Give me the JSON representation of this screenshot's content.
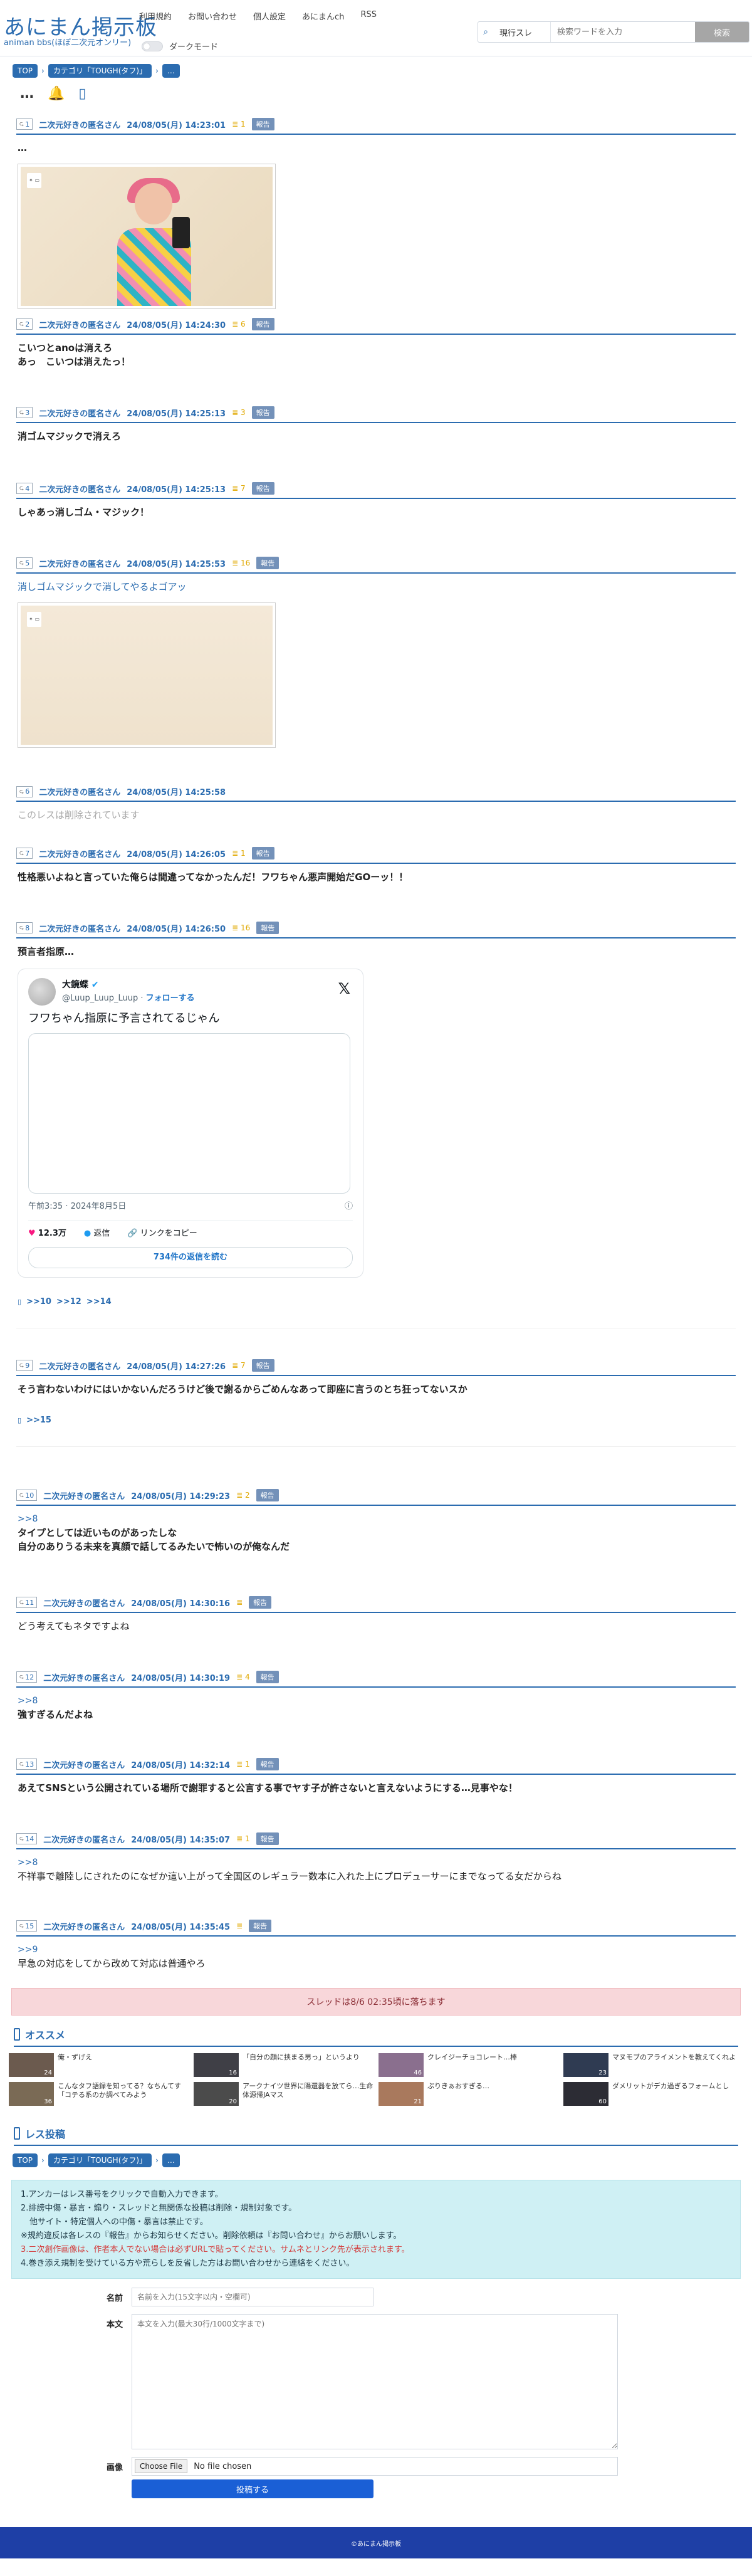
{
  "header": {
    "logo_main": "あにまん掲示板",
    "logo_sub": "animan bbs(ほぼ二次元オンリー)",
    "nav": [
      "利用規約",
      "お問い合わせ",
      "個人設定",
      "あにまんch",
      "RSS"
    ],
    "darkmode_label": "ダークモード",
    "search_scope": "現行スレ",
    "search_placeholder": "検索ワードを入力",
    "search_button": "検索"
  },
  "breadcrumb": {
    "top": "TOP",
    "category": "カテゴリ「TOUGH(タフ)」",
    "current": "…"
  },
  "thread_icons": {
    "menu": "…",
    "bell": "bell-icon",
    "book": "book-icon"
  },
  "posts": [
    {
      "num": "1",
      "name": "二次元好きの匿名さん",
      "date": "24/08/05(月) 14:23:01",
      "refs": "1",
      "report": "報告",
      "body_lines": [
        "…"
      ],
      "has_image": true
    },
    {
      "num": "2",
      "name": "二次元好きの匿名さん",
      "date": "24/08/05(月) 14:24:30",
      "refs": "6",
      "report": "報告",
      "body_lines": [
        "こいつとanoは消えろ",
        "あっ　こいつは消えたっ！"
      ]
    },
    {
      "num": "3",
      "name": "二次元好きの匿名さん",
      "date": "24/08/05(月) 14:25:13",
      "refs": "3",
      "report": "報告",
      "body_lines": [
        "消ゴムマジックで消えろ"
      ]
    },
    {
      "num": "4",
      "name": "二次元好きの匿名さん",
      "date": "24/08/05(月) 14:25:13",
      "refs": "7",
      "report": "報告",
      "body_lines": [
        "しゃあっ消しゴム・マジック！"
      ]
    },
    {
      "num": "5",
      "name": "二次元好きの匿名さん",
      "date": "24/08/05(月) 14:25:53",
      "refs": "16",
      "report": "報告",
      "body_lines": [
        "消しゴムマジックで消してやるよゴアッ"
      ],
      "has_image": true
    },
    {
      "num": "6",
      "name": "二次元好きの匿名さん",
      "date": "24/08/05(月) 14:25:58",
      "body_lines": [
        "このレスは削除されています"
      ]
    },
    {
      "num": "7",
      "name": "二次元好きの匿名さん",
      "date": "24/08/05(月) 14:26:05",
      "refs": "1",
      "report": "報告",
      "body_lines": [
        "性格悪いよねと言っていた俺らは間違ってなかったんだ！フワちゃん悪声開始だGOーッ！！"
      ]
    },
    {
      "num": "8",
      "name": "二次元好きの匿名さん",
      "date": "24/08/05(月) 14:26:50",
      "refs": "16",
      "report": "報告",
      "body_lines": [
        "預言者指原…"
      ],
      "replies": [
        ">>10",
        ">>12",
        ">>14"
      ]
    },
    {
      "num": "9",
      "name": "二次元好きの匿名さん",
      "date": "24/08/05(月) 14:27:26",
      "refs": "7",
      "report": "報告",
      "body_lines": [
        "そう言わないわけにはいかないんだろうけど後で謝るからごめんなあって即座に言うのとち狂ってないスか"
      ],
      "replies": [
        ">>15"
      ]
    },
    {
      "num": "10",
      "name": "二次元好きの匿名さん",
      "date": "24/08/05(月) 14:29:23",
      "refs": "2",
      "report": "報告",
      "anchor": ">>8",
      "body_lines": [
        "タイプとしては近いものがあったしな",
        "自分のありうる未来を真顔で話してるみたいで怖いのが俺なんだ"
      ]
    },
    {
      "num": "11",
      "name": "二次元好きの匿名さん",
      "date": "24/08/05(月) 14:30:16",
      "refs": "",
      "report": "報告",
      "body_lines": [
        "どう考えてもネタですよね"
      ]
    },
    {
      "num": "12",
      "name": "二次元好きの匿名さん",
      "date": "24/08/05(月) 14:30:19",
      "refs": "4",
      "report": "報告",
      "anchor": ">>8",
      "body_lines": [
        "強すぎるんだよね"
      ]
    },
    {
      "num": "13",
      "name": "二次元好きの匿名さん",
      "date": "24/08/05(月) 14:32:14",
      "refs": "1",
      "report": "報告",
      "body_lines": [
        "あえてSNSという公開されている場所で謝罪すると公言する事でヤす子が許さないと言えないようにする…見事やな！"
      ]
    },
    {
      "num": "14",
      "name": "二次元好きの匿名さん",
      "date": "24/08/05(月) 14:35:07",
      "refs": "1",
      "report": "報告",
      "anchor": ">>8",
      "body_lines": [
        "不祥事で離陸しにされたのになぜか這い上がって全国区のレギュラー数本に入れた上にプロデューサーにまでなってる女だからね"
      ]
    },
    {
      "num": "15",
      "name": "二次元好きの匿名さん",
      "date": "24/08/05(月) 14:35:45",
      "refs": "",
      "report": "報告",
      "anchor": ">>9",
      "body_lines": [
        "早急の対応をしてから改めて対応は普通やろ"
      ]
    }
  ],
  "tweet": {
    "name": "大鏡蝶",
    "handle": "@Luup_Luup_Luup",
    "follow": "フォローする",
    "text": "フワちゃん指原に予言されてるじゃん",
    "time": "午前3:35 · 2024年8月5日",
    "likes": "12.3万",
    "reply_label": "返信",
    "copy_label": "リンクをコピー",
    "read_more": "734件の返信を読む"
  },
  "deadline": "スレッドは8/6 02:35頃に落ちます",
  "recommend": {
    "title": "オススメ",
    "items": [
      {
        "text": "俺・ずげえ",
        "count": "24"
      },
      {
        "text": "「自分の顔に挟まる男っ」というより",
        "count": "16"
      },
      {
        "text": "クレイジーチョコレート…棒",
        "count": "46"
      },
      {
        "text": "マヌモブのアライメントを教えてくれよ",
        "count": "23"
      },
      {
        "text": "こんなタフ語録を知ってる？なちんてす「コテる系のか調べてみよう",
        "count": "36"
      },
      {
        "text": "アークナイツ世界に陽還器を放てら…生命体源帰JAマス",
        "count": "20"
      },
      {
        "text": "ぷりきぁおすぎる…",
        "count": "21"
      },
      {
        "text": "ダメリットがデカ過ぎるフォームとし",
        "count": "60"
      }
    ]
  },
  "post_form": {
    "title": "レス投稿",
    "rules": [
      "1.アンカーはレス番号をクリックで自動入力できます。",
      "2.誹謗中傷・暴言・煽り・スレッドと無関係な投稿は削除・規制対象です。",
      "他サイト・特定個人への中傷・暴言は禁止です。",
      "※規約違反は各レスの『報告』からお知らせください。削除依頼は『お問い合わせ』からお願いします。",
      "3.二次創作画像は、作者本人でない場合は必ずURLで貼ってください。サムネとリンク先が表示されます。",
      "4.巻き添え規制を受けている方や荒らしを反省した方はお問い合わせから連絡をください。"
    ],
    "name_label": "名前",
    "name_placeholder": "名前を入力(15文字以内・空欄可)",
    "body_label": "本文",
    "body_placeholder": "本文を入力(最大30行/1000文字まで)",
    "image_label": "画像",
    "file_button": "Choose File",
    "file_status": "No file chosen",
    "submit": "投稿する"
  },
  "footer": "©あにまん掲示板"
}
